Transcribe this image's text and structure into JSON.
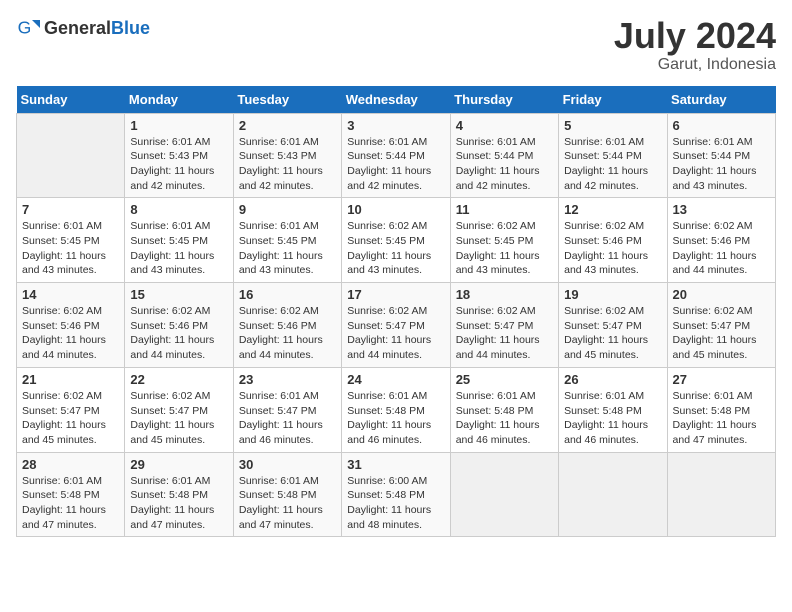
{
  "logo": {
    "text_general": "General",
    "text_blue": "Blue"
  },
  "title": "July 2024",
  "subtitle": "Garut, Indonesia",
  "days_of_week": [
    "Sunday",
    "Monday",
    "Tuesday",
    "Wednesday",
    "Thursday",
    "Friday",
    "Saturday"
  ],
  "weeks": [
    [
      {
        "day": "",
        "info": ""
      },
      {
        "day": "1",
        "info": "Sunrise: 6:01 AM\nSunset: 5:43 PM\nDaylight: 11 hours\nand 42 minutes."
      },
      {
        "day": "2",
        "info": "Sunrise: 6:01 AM\nSunset: 5:43 PM\nDaylight: 11 hours\nand 42 minutes."
      },
      {
        "day": "3",
        "info": "Sunrise: 6:01 AM\nSunset: 5:44 PM\nDaylight: 11 hours\nand 42 minutes."
      },
      {
        "day": "4",
        "info": "Sunrise: 6:01 AM\nSunset: 5:44 PM\nDaylight: 11 hours\nand 42 minutes."
      },
      {
        "day": "5",
        "info": "Sunrise: 6:01 AM\nSunset: 5:44 PM\nDaylight: 11 hours\nand 42 minutes."
      },
      {
        "day": "6",
        "info": "Sunrise: 6:01 AM\nSunset: 5:44 PM\nDaylight: 11 hours\nand 43 minutes."
      }
    ],
    [
      {
        "day": "7",
        "info": "Sunrise: 6:01 AM\nSunset: 5:45 PM\nDaylight: 11 hours\nand 43 minutes."
      },
      {
        "day": "8",
        "info": "Sunrise: 6:01 AM\nSunset: 5:45 PM\nDaylight: 11 hours\nand 43 minutes."
      },
      {
        "day": "9",
        "info": "Sunrise: 6:01 AM\nSunset: 5:45 PM\nDaylight: 11 hours\nand 43 minutes."
      },
      {
        "day": "10",
        "info": "Sunrise: 6:02 AM\nSunset: 5:45 PM\nDaylight: 11 hours\nand 43 minutes."
      },
      {
        "day": "11",
        "info": "Sunrise: 6:02 AM\nSunset: 5:45 PM\nDaylight: 11 hours\nand 43 minutes."
      },
      {
        "day": "12",
        "info": "Sunrise: 6:02 AM\nSunset: 5:46 PM\nDaylight: 11 hours\nand 43 minutes."
      },
      {
        "day": "13",
        "info": "Sunrise: 6:02 AM\nSunset: 5:46 PM\nDaylight: 11 hours\nand 44 minutes."
      }
    ],
    [
      {
        "day": "14",
        "info": "Sunrise: 6:02 AM\nSunset: 5:46 PM\nDaylight: 11 hours\nand 44 minutes."
      },
      {
        "day": "15",
        "info": "Sunrise: 6:02 AM\nSunset: 5:46 PM\nDaylight: 11 hours\nand 44 minutes."
      },
      {
        "day": "16",
        "info": "Sunrise: 6:02 AM\nSunset: 5:46 PM\nDaylight: 11 hours\nand 44 minutes."
      },
      {
        "day": "17",
        "info": "Sunrise: 6:02 AM\nSunset: 5:47 PM\nDaylight: 11 hours\nand 44 minutes."
      },
      {
        "day": "18",
        "info": "Sunrise: 6:02 AM\nSunset: 5:47 PM\nDaylight: 11 hours\nand 44 minutes."
      },
      {
        "day": "19",
        "info": "Sunrise: 6:02 AM\nSunset: 5:47 PM\nDaylight: 11 hours\nand 45 minutes."
      },
      {
        "day": "20",
        "info": "Sunrise: 6:02 AM\nSunset: 5:47 PM\nDaylight: 11 hours\nand 45 minutes."
      }
    ],
    [
      {
        "day": "21",
        "info": "Sunrise: 6:02 AM\nSunset: 5:47 PM\nDaylight: 11 hours\nand 45 minutes."
      },
      {
        "day": "22",
        "info": "Sunrise: 6:02 AM\nSunset: 5:47 PM\nDaylight: 11 hours\nand 45 minutes."
      },
      {
        "day": "23",
        "info": "Sunrise: 6:01 AM\nSunset: 5:47 PM\nDaylight: 11 hours\nand 46 minutes."
      },
      {
        "day": "24",
        "info": "Sunrise: 6:01 AM\nSunset: 5:48 PM\nDaylight: 11 hours\nand 46 minutes."
      },
      {
        "day": "25",
        "info": "Sunrise: 6:01 AM\nSunset: 5:48 PM\nDaylight: 11 hours\nand 46 minutes."
      },
      {
        "day": "26",
        "info": "Sunrise: 6:01 AM\nSunset: 5:48 PM\nDaylight: 11 hours\nand 46 minutes."
      },
      {
        "day": "27",
        "info": "Sunrise: 6:01 AM\nSunset: 5:48 PM\nDaylight: 11 hours\nand 47 minutes."
      }
    ],
    [
      {
        "day": "28",
        "info": "Sunrise: 6:01 AM\nSunset: 5:48 PM\nDaylight: 11 hours\nand 47 minutes."
      },
      {
        "day": "29",
        "info": "Sunrise: 6:01 AM\nSunset: 5:48 PM\nDaylight: 11 hours\nand 47 minutes."
      },
      {
        "day": "30",
        "info": "Sunrise: 6:01 AM\nSunset: 5:48 PM\nDaylight: 11 hours\nand 47 minutes."
      },
      {
        "day": "31",
        "info": "Sunrise: 6:00 AM\nSunset: 5:48 PM\nDaylight: 11 hours\nand 48 minutes."
      },
      {
        "day": "",
        "info": ""
      },
      {
        "day": "",
        "info": ""
      },
      {
        "day": "",
        "info": ""
      }
    ]
  ]
}
